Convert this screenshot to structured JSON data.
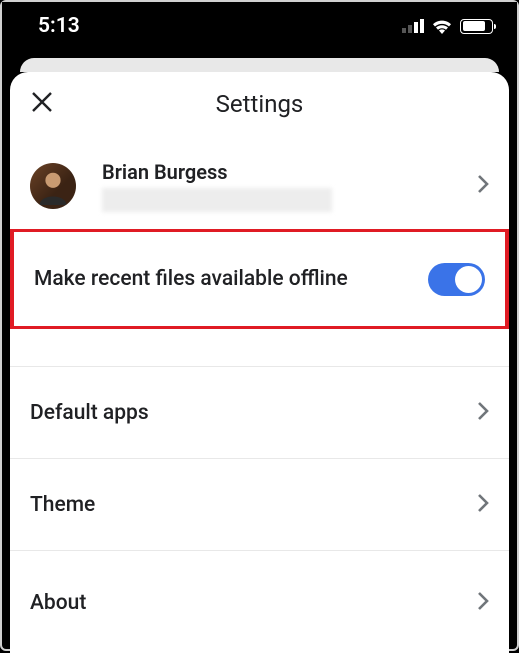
{
  "status": {
    "time": "5:13"
  },
  "header": {
    "title": "Settings"
  },
  "account": {
    "name": "Brian Burgess"
  },
  "offline": {
    "label": "Make recent files available offline",
    "enabled": true
  },
  "rows": {
    "defaultApps": "Default apps",
    "theme": "Theme",
    "about": "About"
  }
}
